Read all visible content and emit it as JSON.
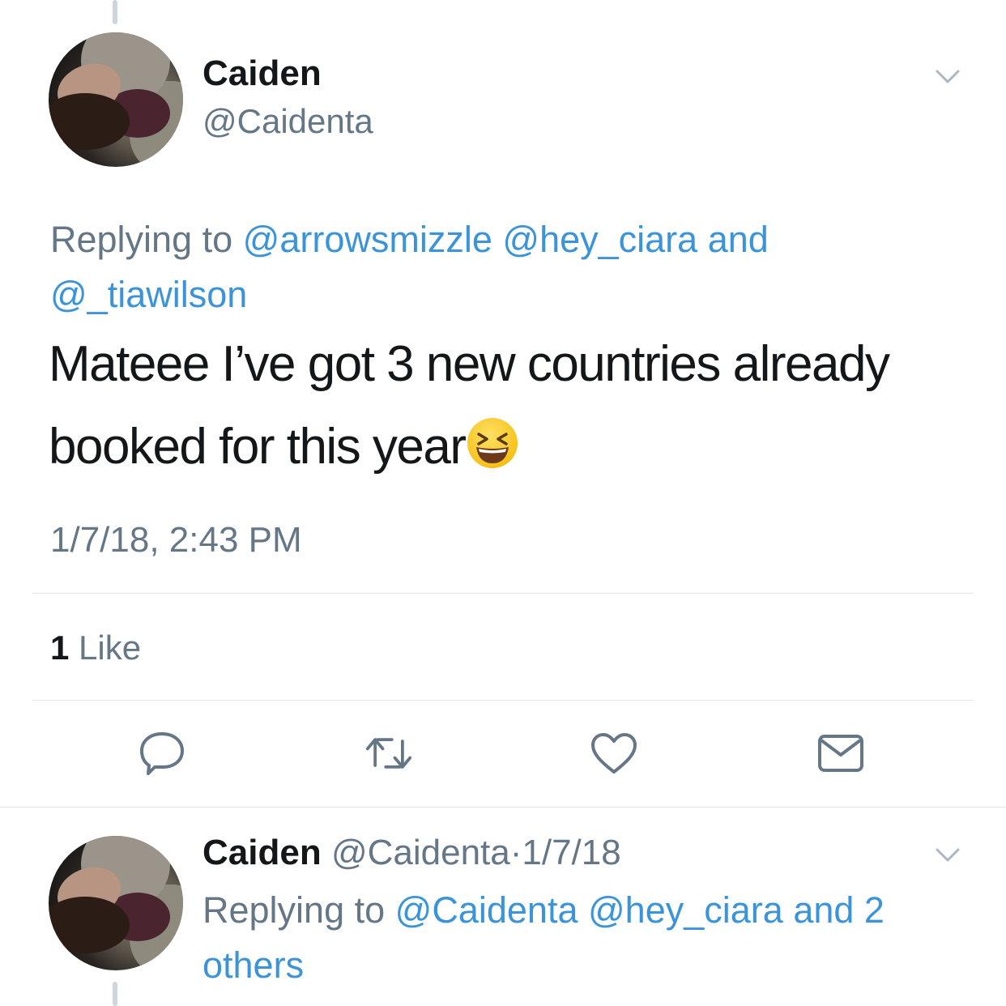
{
  "main_tweet": {
    "name": "Caiden",
    "handle": "@Caidenta",
    "replying_prefix": "Replying to",
    "reply_handle_1": "@arrowsmizzle",
    "reply_handle_2": "@hey_ciara",
    "reply_and": "and",
    "reply_handle_3": "@_tiawilson",
    "text_line1": "Mateee I’ve got 3 new countries already",
    "text_line2": "booked for this year",
    "emoji": "laughing-squinting-face",
    "timestamp": "1/7/18, 2:43 PM",
    "likes_count": "1",
    "likes_label": "Like"
  },
  "reply_tweet": {
    "name": "Caiden",
    "handle": "@Caidenta",
    "separator": "·",
    "date": "1/7/18",
    "replying_prefix": "Replying to",
    "reply_handle_1": "@Caidenta",
    "reply_handle_2": "@hey_ciara",
    "reply_and_more": "and 2",
    "reply_others": "others"
  },
  "icons": {
    "reply": "speech-bubble-icon",
    "retweet": "retweet-icon",
    "like": "heart-icon",
    "dm": "envelope-icon",
    "more": "chevron-down-icon"
  },
  "colors": {
    "link": "#3b94d9",
    "muted": "#657786",
    "text": "#14171a",
    "divider": "#e1e8ed"
  }
}
